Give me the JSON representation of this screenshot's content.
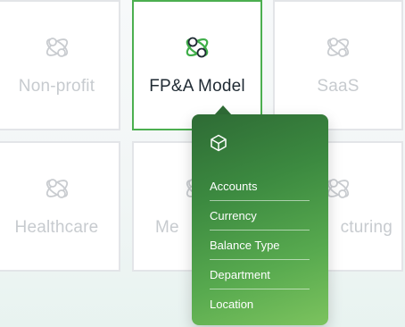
{
  "cards": {
    "nonprofit": "Non-profit",
    "fpa": "FP&A Model",
    "saas": "SaaS",
    "healthcare": "Healthcare",
    "media_partial": "Me",
    "manufacturing_partial": "cturing"
  },
  "popup": {
    "icon": "cube-icon",
    "items": [
      "Accounts",
      "Currency",
      "Balance Type",
      "Department",
      "Location"
    ]
  },
  "colors": {
    "accent_green": "#4caf50",
    "popup_gradient_start": "#2e6b35",
    "popup_gradient_end": "#7cc35e",
    "muted_text": "#c7cbcf"
  }
}
